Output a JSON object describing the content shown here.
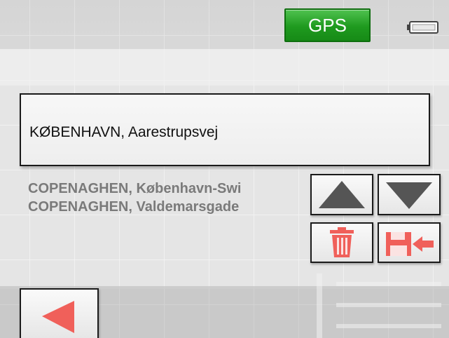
{
  "status": {
    "gps_label": "GPS",
    "gps_color": "#1f9a1f",
    "battery_icon": "battery-icon"
  },
  "address_input": {
    "value": "KØBENHAVN, Aarestrupsvej"
  },
  "history": {
    "items": [
      "COPENAGHEN, København-Swi",
      "COPENAGHEN, Valdemarsgade"
    ]
  },
  "controls": {
    "scroll_up_icon": "arrow-up-icon",
    "scroll_down_icon": "arrow-down-icon",
    "delete_icon": "trash-icon",
    "save_icon": "save-icon",
    "back_icon": "back-arrow-icon",
    "accent_color": "#f0605a",
    "arrow_color": "#555555"
  }
}
